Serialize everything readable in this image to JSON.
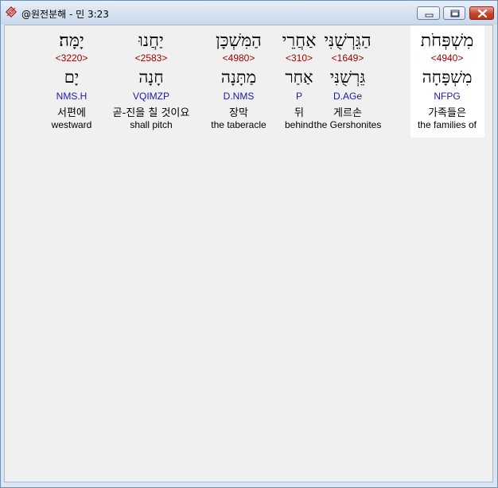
{
  "window": {
    "title": "@원전분해 - 민 3:23"
  },
  "words": [
    {
      "hebrew": "מִשְׁפְּחֹת",
      "strong": "<4940>",
      "lemma": "מִשְׁפָּחָה",
      "morph": "NFPG",
      "korean": "가족들은",
      "english": "the families of",
      "selected": true
    },
    {
      "hebrew": "הַגֵּרְשֻׁנִּי",
      "strong": "<1649>",
      "lemma": "גֵּרְשֻׁנִּי",
      "morph": "D.AGe",
      "korean": "게르손",
      "english": "the Gershonites",
      "selected": false
    },
    {
      "hebrew": "אַחֲרֵי",
      "strong": "<310>",
      "lemma": "אַחַר",
      "morph": "P",
      "korean": "뒤",
      "english": "behind",
      "selected": false
    },
    {
      "hebrew": "הַמִּשְׁכָּן",
      "strong": "<4980>",
      "lemma": "מַתָּנָה",
      "morph": "D.NMS",
      "korean": "장막",
      "english": "the taberacle",
      "selected": false
    },
    {
      "hebrew": "יַחֲנוּ",
      "strong": "<2583>",
      "lemma": "חָנָה",
      "morph": "VQIMZP",
      "korean": "곧-진을 칠 것이요",
      "english": "shall pitch",
      "selected": false
    },
    {
      "hebrew": "יָמָּה׃",
      "strong": "<3220>",
      "lemma": "יָם",
      "morph": "NMS.H",
      "korean": "서편에",
      "english": "westward",
      "selected": false
    }
  ]
}
